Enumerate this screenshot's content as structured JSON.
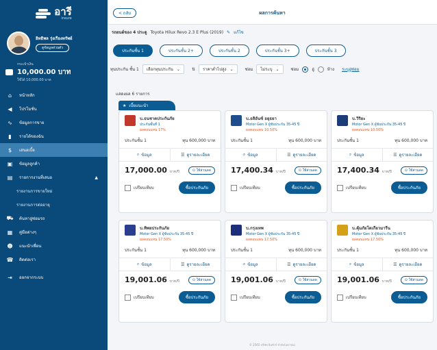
{
  "app": {
    "logo_text": "อารี",
    "logo_sub": "insure"
  },
  "profile": {
    "name": "อิทธิพล รุ่งเรืองทรัพย์",
    "button_label": "ดูข้อมูลส่วนตัว"
  },
  "balance": {
    "label": "กระเป๋าเงิน",
    "value": "10,000.00 บาท",
    "sub": "ใช้ได้ 10,000.00 บาท"
  },
  "nav": {
    "items": [
      {
        "label": "หน้าหลัก",
        "icon": "home-icon"
      },
      {
        "label": "โปรโมชั่น",
        "icon": "megaphone-icon"
      },
      {
        "label": "ข้อมูลการขาย",
        "icon": "trend-icon"
      },
      {
        "label": "รายได้ของฉัน",
        "icon": "bar-chart-icon"
      },
      {
        "label": "เสนอเบี้ย",
        "icon": "money-icon"
      },
      {
        "label": "ข้อมูลลูกค้า",
        "icon": "id-card-icon"
      },
      {
        "label": "รายการงานที่เสนอ",
        "icon": "document-icon"
      }
    ],
    "sub_items": [
      "รายงานการขายใหม่",
      "รายงานการต่ออายุ"
    ],
    "bottom_items": [
      {
        "label": "ค้นหาอู่ซ่อมรถ",
        "icon": "car-icon"
      },
      {
        "label": "คู่มือต่างๆ",
        "icon": "book-icon"
      },
      {
        "label": "แนะนำเพื่อน",
        "icon": "users-icon"
      },
      {
        "label": "ติดต่อเรา",
        "icon": "support-icon"
      },
      {
        "label": "ออกจากระบบ",
        "icon": "logout-icon"
      }
    ]
  },
  "header": {
    "back_label": "< กลับ",
    "title": "ผลการค้นหา"
  },
  "summary": {
    "label": "รถยนต์ของ 4 ประตู",
    "vehicle": "Toyota Hilux Revo 2.3 E Plus (2019)",
    "edit_label": "แก้ไข"
  },
  "chips": [
    "ประกันชั้น 1",
    "ประกันชั้น 2+",
    "ประกันชั้น 2",
    "ประกันชั้น 3+",
    "ประกันชั้น 3"
  ],
  "filters": {
    "type_label": "ทุนประกัน ชั้น 1",
    "type_value": "เลือกทุนประกัน",
    "sort_label": "ราคาต่ำไปสูง",
    "repair_label": "ซ่อม",
    "repair_value": "ไม่ระบุ",
    "radio_label": "ซ่อม",
    "radio_a": "อู่",
    "radio_b": "ห้าง",
    "reset_label": "ระบุอู่ซ่อม"
  },
  "results": {
    "count_text": "แสดงผล 6 รายการ",
    "recommend_label": "เบี้ยแนะนำ"
  },
  "card_labels": {
    "coverage_type": "ประกันชั้น 1",
    "info_btn": "ข้อมูล",
    "detail_btn": "ดูรายละเอียด",
    "pay_badge": "ใช้ส่วนลด",
    "compare": "เปรียบเทียบ",
    "buy": "ซื้อประกันภัย",
    "price_unit": "บาท/ปี"
  },
  "cards": [
    {
      "name": "บ.ธนชาตประกันภัย",
      "plan": "ประกันชั้นที่ 1",
      "discount": "ผลตอบแทน 17%",
      "sum": "ทุน 600,000 บาท",
      "price": "17,000.00",
      "logo_color": "#c0392b"
    },
    {
      "name": "บ.อลิอันซ์ อยุธยา",
      "plan": "Motor Gen X ผู้ขับประกัน 35-45 ปี",
      "discount": "ผลตอบแทน 10.50%",
      "sum": "ทุน 600,000 บาท",
      "price": "17,400.34",
      "logo_color": "#1f4e8c"
    },
    {
      "name": "บ.วิริยะ",
      "plan": "Motor Gen X ผู้ขับประกัน 35-45 ปี",
      "discount": "ผลตอบแทน 10.50%",
      "sum": "ทุน 600,000 บาท",
      "price": "17,400.34",
      "logo_color": "#1b3c78"
    },
    {
      "name": "บ.ทิพยประกันภัย",
      "plan": "Motor Gen X ผู้ขับประกัน 35-45 ปี",
      "discount": "ผลตอบแทน 17.50%",
      "sum": "ทุน 600,000 บาท",
      "price": "19,001.06",
      "logo_color": "#2a3f8f"
    },
    {
      "name": "บ.กรุงเทพ",
      "plan": "Motor Gen X ผู้ขับประกัน 35-45 ปี",
      "discount": "ผลตอบแทน 17.50%",
      "sum": "ทุน 600,000 บาท",
      "price": "19,001.06",
      "logo_color": "#1d2f7a"
    },
    {
      "name": "บ.คุ้มภัยโตเกียวมารีน",
      "plan": "Motor Gen X ผู้ขับประกัน 35-45 ปี",
      "discount": "ผลตอบแทน 17.50%",
      "sum": "ทุน 600,000 บาท",
      "price": "19,001.06",
      "logo_color": "#d4a017"
    }
  ],
  "footer": "© 2565 บริษัท อินชัวร์ จำกัด(มหาชน)"
}
